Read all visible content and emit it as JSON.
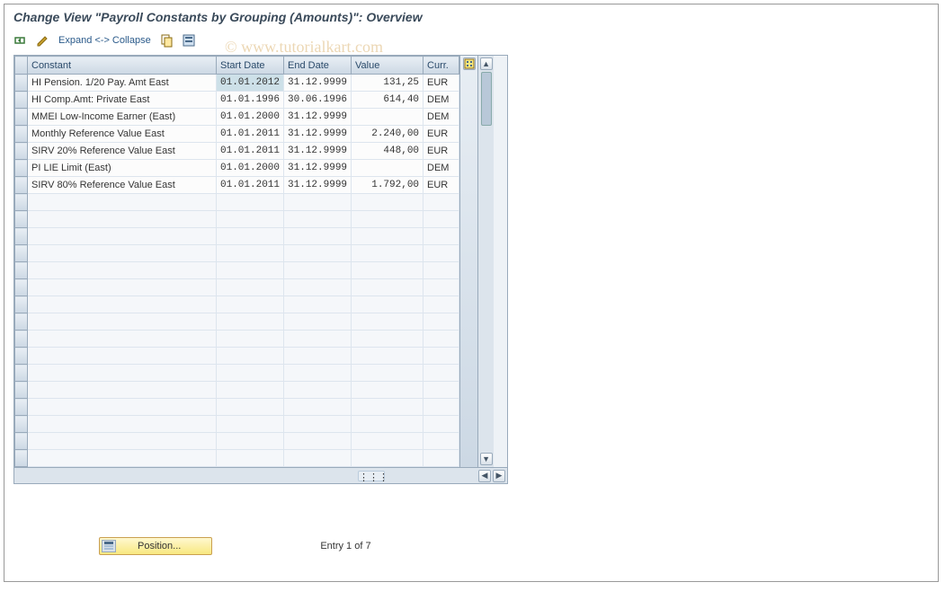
{
  "title": "Change View \"Payroll Constants by Grouping (Amounts)\": Overview",
  "toolbar": {
    "expand_label": "Expand <-> Collapse"
  },
  "table": {
    "headers": {
      "constant": "Constant",
      "start_date": "Start Date",
      "end_date": "End Date",
      "value": "Value",
      "currency": "Curr."
    },
    "rows": [
      {
        "constant": "HI Pension. 1/20 Pay. Amt East",
        "start": "01.01.2012",
        "end": "31.12.9999",
        "value": "131,25",
        "curr": "EUR",
        "selected": true
      },
      {
        "constant": "HI Comp.Amt: Private  East",
        "start": "01.01.1996",
        "end": "30.06.1996",
        "value": "614,40",
        "curr": "DEM"
      },
      {
        "constant": "MMEI Low-Income Earner (East)",
        "start": "01.01.2000",
        "end": "31.12.9999",
        "value": "",
        "curr": "DEM"
      },
      {
        "constant": "Monthly Reference Value East",
        "start": "01.01.2011",
        "end": "31.12.9999",
        "value": "2.240,00",
        "curr": "EUR"
      },
      {
        "constant": "SIRV 20% Reference Value East",
        "start": "01.01.2011",
        "end": "31.12.9999",
        "value": "448,00",
        "curr": "EUR"
      },
      {
        "constant": "PI LIE Limit (East)",
        "start": "01.01.2000",
        "end": "31.12.9999",
        "value": "",
        "curr": "DEM"
      },
      {
        "constant": "SIRV 80% Reference Value East",
        "start": "01.01.2011",
        "end": "31.12.9999",
        "value": "1.792,00",
        "curr": "EUR"
      }
    ],
    "empty_rows": 16
  },
  "footer": {
    "position_label": "Position...",
    "entry_label": "Entry 1 of 7"
  },
  "watermark": "© www.tutorialkart.com"
}
